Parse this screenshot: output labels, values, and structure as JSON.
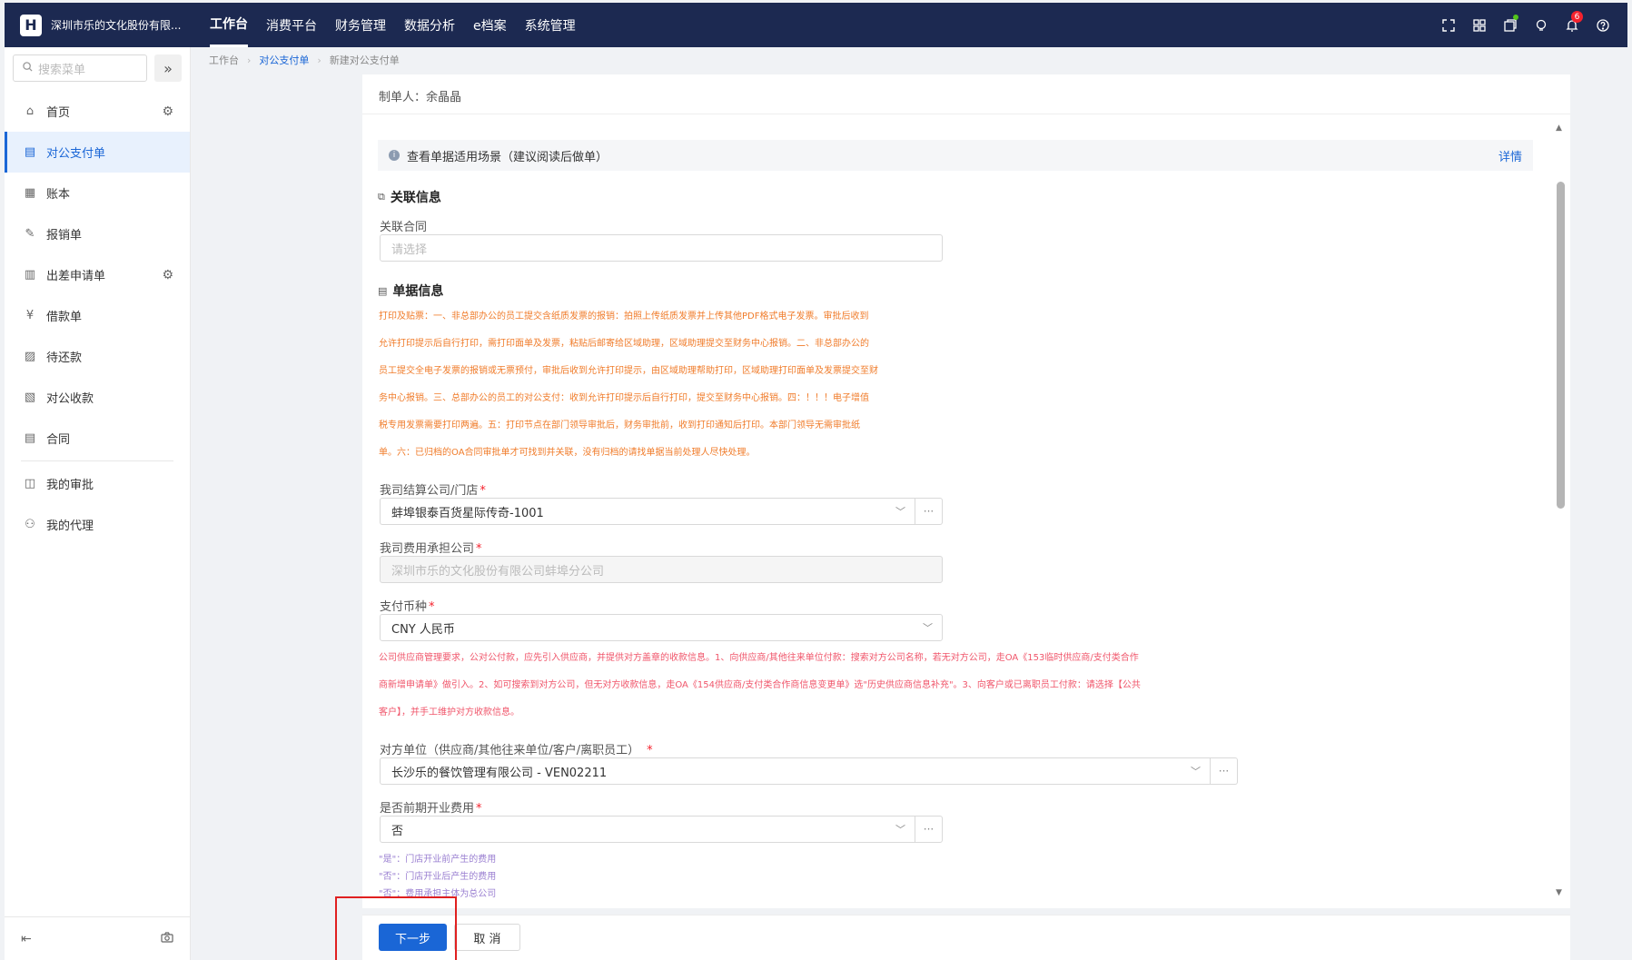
{
  "header": {
    "logo_glyph": "H",
    "company": "深圳市乐的文化股份有限...",
    "menu": [
      {
        "label": "工作台",
        "active": true
      },
      {
        "label": "消费平台",
        "active": false
      },
      {
        "label": "财务管理",
        "active": false
      },
      {
        "label": "数据分析",
        "active": false
      },
      {
        "label": "e档案",
        "active": false
      },
      {
        "label": "系统管理",
        "active": false
      }
    ],
    "icons": [
      "fullscreen-icon",
      "apps-grid-icon",
      "task-icon",
      "lightbulb-icon",
      "bell-icon",
      "help-icon"
    ],
    "notification_count": "6"
  },
  "sidebar": {
    "search_placeholder": "搜索菜单",
    "items": [
      {
        "label": "首页",
        "icon": "home-icon",
        "gear": true
      },
      {
        "label": "对公支付单",
        "icon": "payment-doc-icon",
        "active": true
      },
      {
        "label": "账本",
        "icon": "ledger-icon"
      },
      {
        "label": "报销单",
        "icon": "reimburse-icon"
      },
      {
        "label": "出差申请单",
        "icon": "travel-doc-icon",
        "gear": true
      },
      {
        "label": "借款单",
        "icon": "loan-icon"
      },
      {
        "label": "待还款",
        "icon": "repay-icon"
      },
      {
        "label": "对公收款",
        "icon": "receipt-icon"
      },
      {
        "label": "合同",
        "icon": "contract-icon"
      },
      {
        "label": "我的审批",
        "icon": "approval-icon"
      },
      {
        "label": "我的代理",
        "icon": "agent-icon"
      }
    ]
  },
  "breadcrumb": {
    "items": [
      "工作台",
      "对公支付单",
      "新建对公支付单"
    ]
  },
  "form": {
    "maker_label": "制单人：",
    "maker_name": "余晶晶",
    "info_text": "查看单据适用场景（建议阅读后做单）",
    "info_link": "详情",
    "section_related": "关联信息",
    "contract_label": "关联合同",
    "contract_placeholder": "请选择",
    "section_doc": "单据信息",
    "notice_lines": [
      "打印及贴票：一、非总部办公的员工提交含纸质发票的报销：拍照上传纸质发票并上传其他PDF格式电子发票。审批后收到",
      "允许打印提示后自行打印，需打印面单及发票，粘贴后邮寄给区域助理，区域助理提交至财务中心报销。二、非总部办公的",
      "员工提交全电子发票的报销或无票预付，审批后收到允许打印提示，由区域助理帮助打印，区域助理打印面单及发票提交至财",
      "务中心报销。三、总部办公的员工的对公支付：收到允许打印提示后自行打印，提交至财务中心报销。四：！！！电子增值",
      "税专用发票需要打印两遍。五：打印节点在部门领导审批后，财务审批前，收到打印通知后打印。本部门领导无需审批纸",
      "单。六：已归档的OA合同审批单才可找到并关联，没有归档的请找单据当前处理人尽快处理。"
    ],
    "company_label": "我司结算公司/门店",
    "company_value": "蚌埠银泰百货星际传奇-1001",
    "expense_label": "我司费用承担公司",
    "expense_value": "深圳市乐的文化股份有限公司蚌埠分公司",
    "currency_label": "支付币种",
    "currency_value": "CNY 人民币",
    "supplier_notice_lines": [
      "公司供应商管理要求，公对公付款，应先引入供应商，并提供对方盖章的收款信息。1、向供应商/其他往来单位付款：搜索对方公司名称，若无对方公司，走OA《153临时供应商/支付类合作",
      "商新增申请单》做引入。2、如可搜索到对方公司，但无对方收款信息，走OA《154供应商/支付类合作商信息变更单》选\"历史供应商信息补充\"。3、向客户或已离职员工付款：请选择【公共",
      "客户】，并手工维护对方收款信息。"
    ],
    "counterparty_label": "对方单位（供应商/其他往来单位/客户/离职员工）",
    "counterparty_value": "长沙乐的餐饮管理有限公司 - VEN02211",
    "preopen_label": "是否前期开业费用",
    "preopen_value": "否",
    "preopen_hints": [
      "\"是\"：门店开业前产生的费用",
      "\"否\"：门店开业后产生的费用",
      "\"否\"：费用承担主体为总公司"
    ],
    "required_mark": "*"
  },
  "footer": {
    "next_label": "下一步",
    "cancel_label": "取 消"
  },
  "colors": {
    "topbar": "#1c2951",
    "primary": "#1a66d6",
    "notice_orange": "#f07c2b",
    "notice_red": "#f0566b",
    "hint_purple": "#9a7fd1",
    "highlight_red": "#e02020"
  }
}
